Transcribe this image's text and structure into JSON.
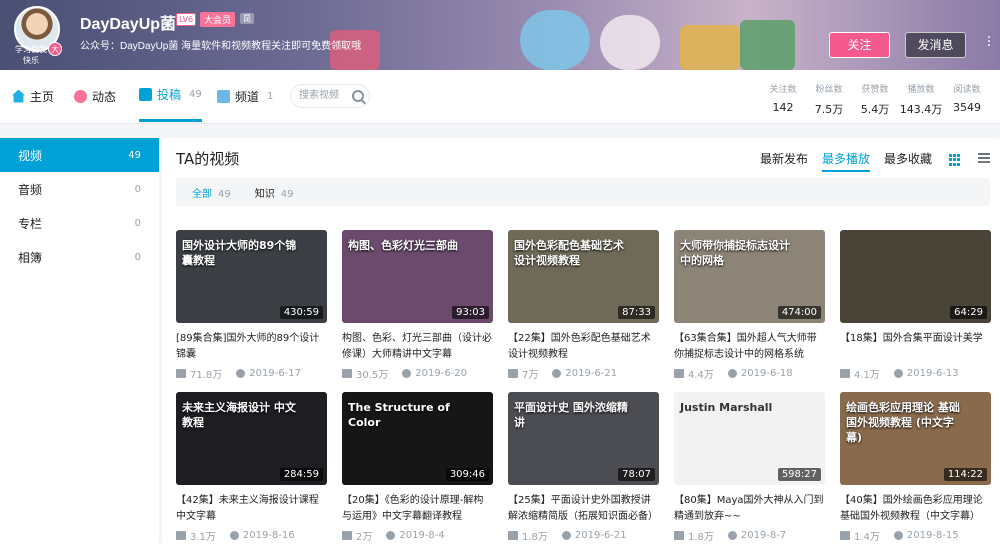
{
  "header": {
    "avatar_caption": "学习使我快乐",
    "vip_dot": "大",
    "username": "DayDayUp菌",
    "level": "LV6",
    "vip_label": "大会员",
    "small_badge": "昆",
    "signature": "公众号：DayDayUp菌 海量软件和视频教程关注即可免费领取哦",
    "follow_label": "关注",
    "message_label": "发消息"
  },
  "nav": {
    "tabs": [
      {
        "label": "主页",
        "count": ""
      },
      {
        "label": "动态",
        "count": ""
      },
      {
        "label": "投稿",
        "count": "49"
      },
      {
        "label": "频道",
        "count": "1"
      }
    ],
    "search_placeholder": "搜索视频",
    "stats": [
      {
        "label": "关注数",
        "value": "142"
      },
      {
        "label": "粉丝数",
        "value": "7.5万"
      },
      {
        "label": "获赞数",
        "value": "5.4万"
      },
      {
        "label": "播放数",
        "value": "143.4万"
      },
      {
        "label": "阅读数",
        "value": "3549"
      }
    ]
  },
  "sidebar": {
    "items": [
      {
        "label": "视频",
        "count": "49"
      },
      {
        "label": "音频",
        "count": "0"
      },
      {
        "label": "专栏",
        "count": "0"
      },
      {
        "label": "相簿",
        "count": "0"
      }
    ]
  },
  "main": {
    "title": "TA的视频",
    "sorts": [
      "最新发布",
      "最多播放",
      "最多收藏"
    ],
    "filters": [
      {
        "label": "全部",
        "count": "49"
      },
      {
        "label": "知识",
        "count": "49"
      }
    ],
    "videos": [
      {
        "caption": "国外设计大师的89个锦囊教程",
        "duration": "430:59",
        "title": "[89集合集]国外大师的89个设计锦囊",
        "plays": "71.8万",
        "date": "2019-6-17",
        "bg": "#3b3f44"
      },
      {
        "caption": "构图、色彩灯光三部曲",
        "duration": "93:03",
        "title": "构图、色彩、灯光三部曲（设计必修课）大师精讲中文字幕",
        "plays": "30.5万",
        "date": "2019-6-20",
        "bg": "#6b4a6e"
      },
      {
        "caption": "国外色彩配色基础艺术设计视频教程",
        "duration": "87:33",
        "title": "【22集】国外色彩配色基础艺术设计视频教程",
        "plays": "7万",
        "date": "2019-6-21",
        "bg": "#6f6a58"
      },
      {
        "caption": "大师带你捕捉标志设计中的网格",
        "duration": "474:00",
        "title": "【63集合集】国外超人气大师带你捕捉标志设计中的网格系统",
        "plays": "4.4万",
        "date": "2019-6-18",
        "bg": "#8d8478"
      },
      {
        "caption": "",
        "duration": "64:29",
        "title": "【18集】国外合集平面设计美学",
        "plays": "4.1万",
        "date": "2019-6-13",
        "bg": "#4a4338"
      },
      {
        "caption": "未来主义海报设计 中文教程",
        "duration": "284:59",
        "title": "【42集】未来主义海报设计课程 中文字幕",
        "plays": "3.1万",
        "date": "2019-8-16",
        "bg": "#1d1d22"
      },
      {
        "caption": "The Structure of Color",
        "duration": "309:46",
        "title": "【20集】《色彩的设计原理-解构与运用》中文字幕翻译教程",
        "plays": "2万",
        "date": "2019-8-4",
        "bg": "#161616"
      },
      {
        "caption": "平面设计史 国外浓缩精讲",
        "duration": "78:07",
        "title": "【25集】平面设计史外国教授讲解浓缩精简版（拓展知识面必备）",
        "plays": "1.8万",
        "date": "2019-6-21",
        "bg": "#4b4d52"
      },
      {
        "caption": "Justin Marshall",
        "duration": "598:27",
        "title": "【80集】Maya国外大神从入门到精通到放弃~~",
        "plays": "1.8万",
        "date": "2019-8-7",
        "bg": "#f2f2f2"
      },
      {
        "caption": "绘画色彩应用理论 基础国外视频教程 (中文字幕)",
        "duration": "114:22",
        "title": "【40集】国外绘画色彩应用理论 基础国外视频教程（中文字幕）",
        "plays": "1.4万",
        "date": "2019-8-15",
        "bg": "#8a6a4c"
      }
    ]
  },
  "colors": {
    "accent": "#00a1d6",
    "pink": "#f45a8d"
  }
}
